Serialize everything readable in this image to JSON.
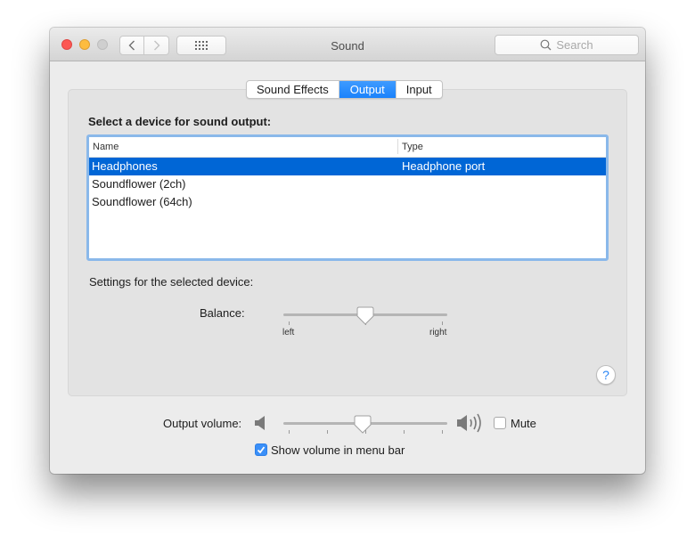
{
  "window": {
    "title": "Sound",
    "search_placeholder": "Search"
  },
  "toolbar": {
    "back_icon": "chevron-left-icon",
    "forward_icon": "chevron-right-icon",
    "show_all_icon": "grid-icon"
  },
  "tabs": [
    {
      "label": "Sound Effects",
      "active": false
    },
    {
      "label": "Output",
      "active": true
    },
    {
      "label": "Input",
      "active": false
    }
  ],
  "output": {
    "heading": "Select a device for sound output:",
    "columns": [
      "Name",
      "Type"
    ],
    "devices": [
      {
        "name": "Headphones",
        "type": "Headphone port",
        "selected": true
      },
      {
        "name": "Soundflower (2ch)",
        "type": "",
        "selected": false
      },
      {
        "name": "Soundflower (64ch)",
        "type": "",
        "selected": false
      }
    ],
    "settings_label": "Settings for the selected device:",
    "balance": {
      "label": "Balance:",
      "min_label": "left",
      "max_label": "right",
      "value": 0.5
    }
  },
  "help_label": "?",
  "volume": {
    "label": "Output volume:",
    "value": 0.48,
    "mute_label": "Mute",
    "mute_checked": false,
    "show_in_menu_bar_label": "Show volume in menu bar",
    "show_in_menu_bar_checked": true
  },
  "colors": {
    "accent": "#1a82fb",
    "selection": "#0066d6",
    "focus_ring": "#8ab8ea",
    "help_icon": "#2a86f6"
  }
}
